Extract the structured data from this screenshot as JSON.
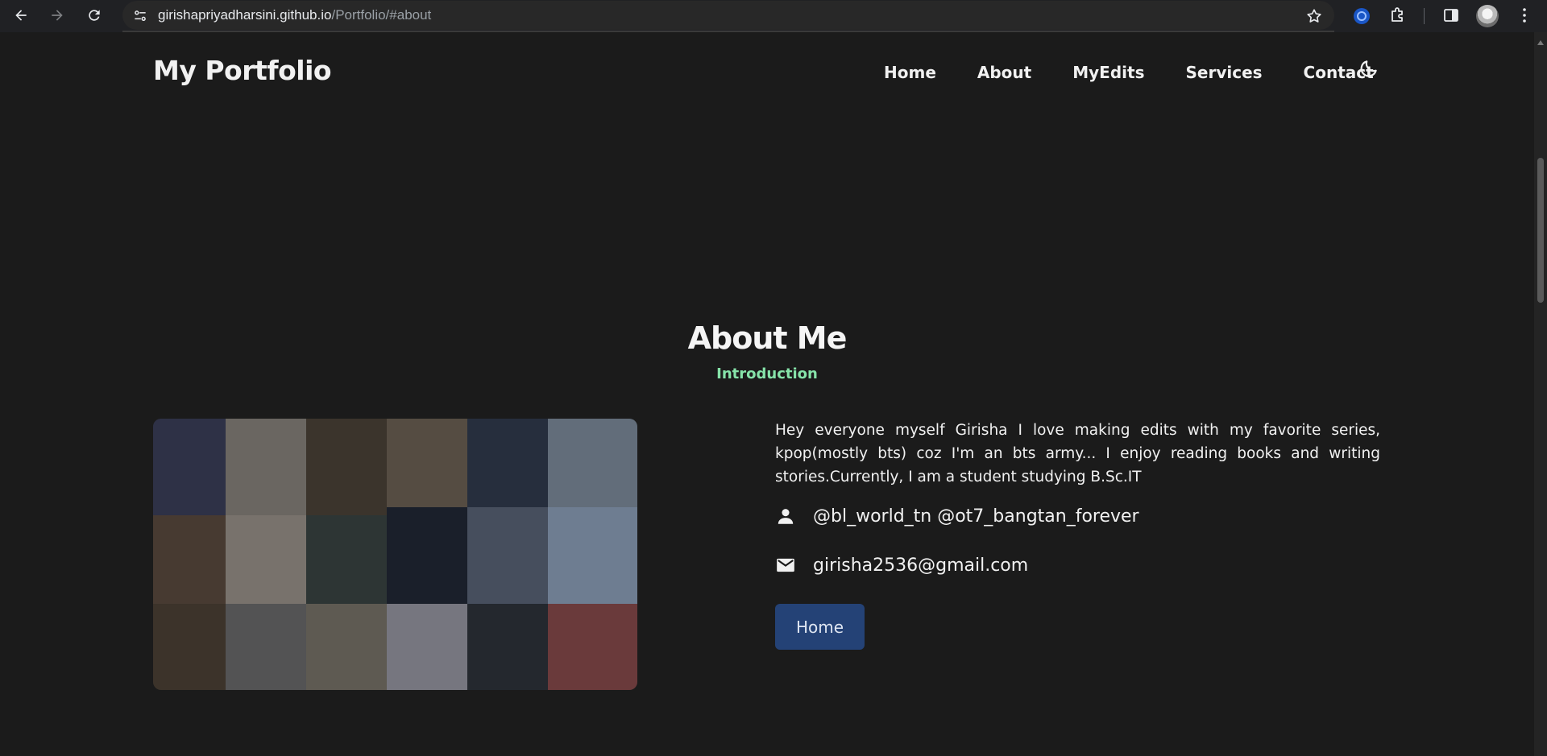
{
  "browser": {
    "url_host": "girishapriyadharsini.github.io",
    "url_path": "/Portfolio/#about"
  },
  "header": {
    "brand": "My Portfolio",
    "nav": [
      "Home",
      "About",
      "MyEdits",
      "Services",
      "Contact"
    ],
    "theme_toggle_icon": "moon-icon"
  },
  "about": {
    "title": "About Me",
    "subtitle": "Introduction",
    "description": "Hey everyone myself Girisha I love making edits with my favorite series, kpop(mostly bts) coz I'm an bts army... I enjoy reading books and writing stories.Currently, I am a student studying B.Sc.IT",
    "social_handles": "@bl_world_tn @ot7_bangtan_forever",
    "email": "girisha2536@gmail.com",
    "button_label": "Home"
  },
  "colors": {
    "background": "#1b1b1b",
    "accent_green": "#86e3a9",
    "button_blue": "#244276"
  }
}
